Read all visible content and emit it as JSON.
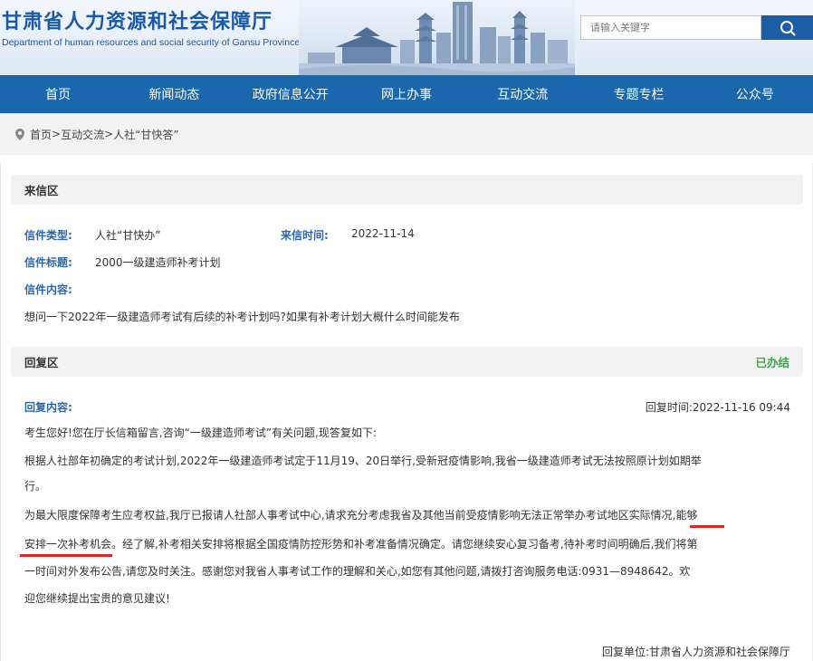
{
  "header": {
    "title": "甘肃省人力资源和社会保障厅",
    "subtitle": "Department of human resources and social security of Gansu Province",
    "search_placeholder": "请输入关键字"
  },
  "nav": {
    "items": [
      "首页",
      "新闻动态",
      "政府信息公开",
      "网上办事",
      "互动交流",
      "专题专栏",
      "公众号"
    ]
  },
  "breadcrumb": {
    "home": "首页",
    "sep1": ">",
    "interact": "互动交流",
    "sep2": ">",
    "current": "人社“甘快答”"
  },
  "letter": {
    "section_title": "来信区",
    "type_label": "信件类型:",
    "type_value": "人社“甘快办”",
    "time_label": "来信时间:",
    "time_value": "2022-11-14",
    "title_label": "信件标题:",
    "title_value": "2000一级建造师补考计划",
    "content_label": "信件内容:",
    "content_value": "想问一下2022年一级建造师考试有后续的补考计划吗?如果有补考计划大概什么时间能发布"
  },
  "reply": {
    "section_title": "回复区",
    "status": "已办结",
    "content_label": "回复内容:",
    "time_text": "回复时间:2022-11-16 09:44",
    "line1": "考生您好!您在厅长信箱留言,咨询“一级建造师考试”有关问题,现答复如下:",
    "line2a": "根据人社部年初确定的考试计划,2022年一级建造师考试定于11月19、20日举行,受新冠疫情影响,我省一级建造师考试无法按照原计划如期举",
    "line2b": "行。",
    "line3a": "为最大限度保障考生应考权益,我厅已报请人社部人事考试中心,请求充分考虑我省及其他当前受疫情影响无法正常举办考试地区实际情况,能够",
    "line3b": "安排一次补考机会。经了解,补考相关安排将根据全国疫情防控形势和补考准备情况确定。请您继续安心复习备考,待补考时间明确后,我们将第",
    "line3c": "一时间对外发布公告,请您及时关注。感谢您对我省人事考试工作的理解和关心,如您有其他问题,请拨打咨询服务电话:0931—8948642。欢",
    "line3d": "迎您继续提出宝贵的意见建议!",
    "unit": "回复单位:甘肃省人力资源和社会保障厅"
  },
  "colors": {
    "brand_blue": "#1b67ad",
    "label_blue": "#2a66a9",
    "status_green": "#3aa54a",
    "highlight_red": "#e0262b"
  }
}
